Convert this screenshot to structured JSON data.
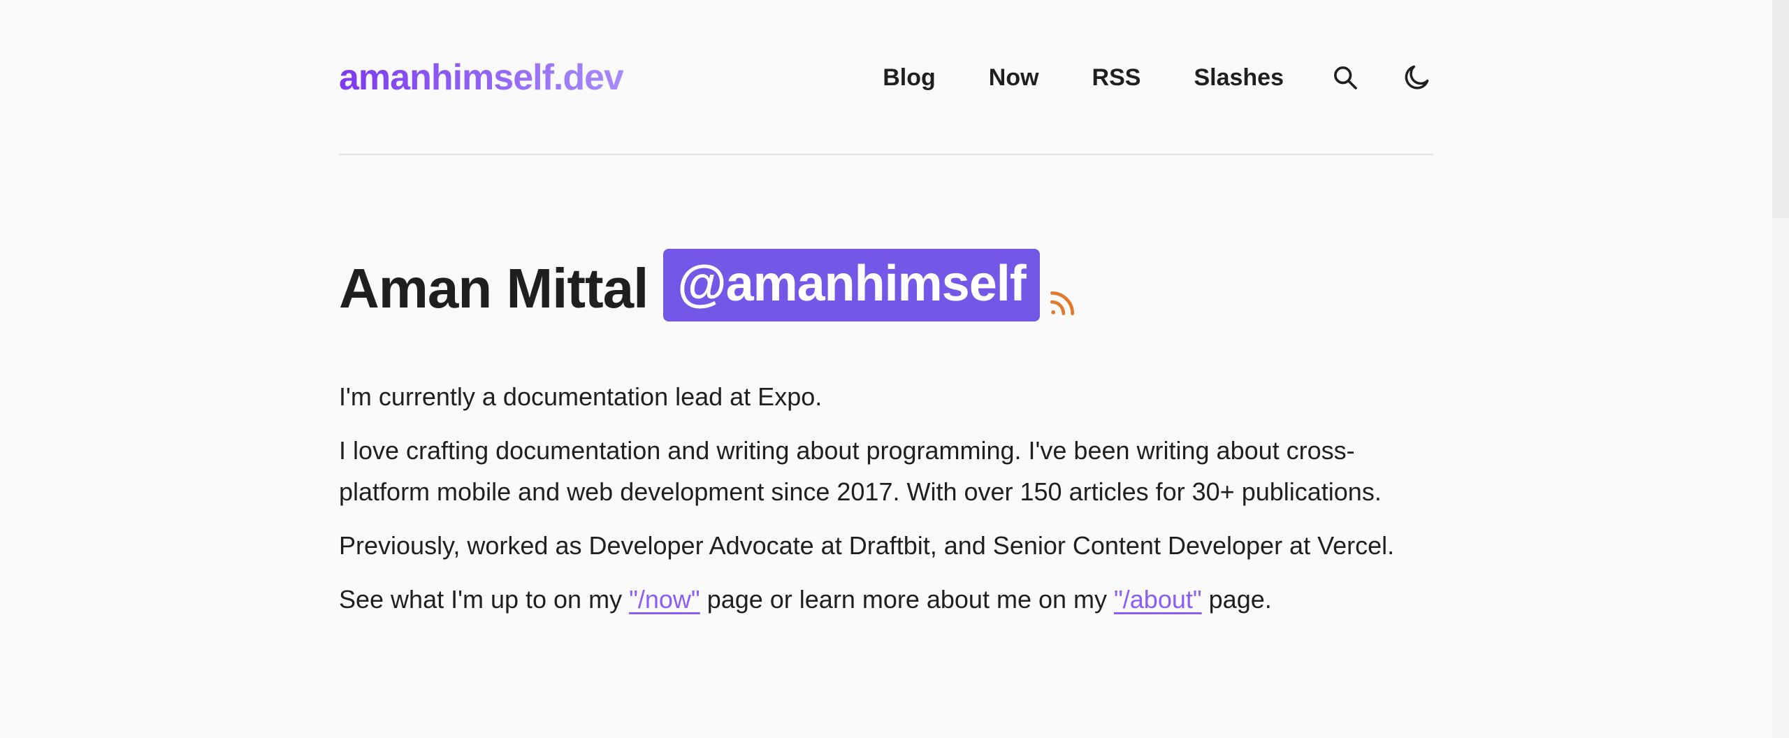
{
  "brand": {
    "text": "amanhimself.dev",
    "gradient_start": "#7c3aed",
    "gradient_end": "#a78bfa"
  },
  "nav": {
    "items": [
      {
        "label": "Blog"
      },
      {
        "label": "Now"
      },
      {
        "label": "RSS"
      },
      {
        "label": "Slashes"
      }
    ],
    "search_icon": "search-icon",
    "theme_icon": "moon-icon"
  },
  "hero": {
    "name": "Aman Mittal",
    "handle": "@amanhimself",
    "handle_bg": "#7457e6",
    "rss_icon": "rss-icon",
    "rss_color": "#e07b2e"
  },
  "bio": {
    "p1": "I'm currently a documentation lead at Expo.",
    "p2": "I love crafting documentation and writing about programming. I've been writing about cross-platform mobile and web development since 2017. With over 150 articles for 30+ publications.",
    "p3": "Previously, worked as Developer Advocate at Draftbit, and Senior Content Developer at Vercel.",
    "p4": {
      "before": "See what I'm up to on my ",
      "link1": "\"/now\"",
      "middle": " page or learn more about me on my ",
      "link2": "\"/about\"",
      "after": " page."
    },
    "link_color": "#8b5cf6"
  }
}
